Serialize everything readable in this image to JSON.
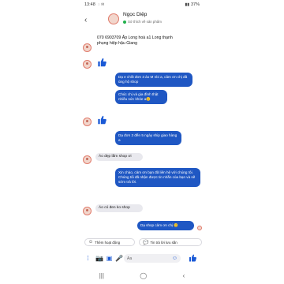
{
  "status": {
    "time": "13:48",
    "battery": "37%"
  },
  "header": {
    "contact_name": "Ngọc Diệp",
    "subtitle": "Sở thích về sản phẩm"
  },
  "messages": [
    {
      "id": "in-1",
      "text": "070 6903709 Ấp Long hoà a1 Long thạnh phụng hiệp hậu Giang"
    },
    {
      "id": "out-1",
      "text": "Dạ e chốt đơn 3 áo M nbi a, cảm ơn chị đã ủng hộ shop"
    },
    {
      "id": "out-2",
      "text": "Chúc chị và gia đình thật nhiều sức khỏe a😊"
    },
    {
      "id": "out-3",
      "text": "Dạ đơn 3 đến 5 ngày ship giao hàng a"
    },
    {
      "id": "in-2",
      "text": "Áo đẹp lắm shop ơi"
    },
    {
      "id": "out-4",
      "text": "Xin chào, cảm ơn bạn đã liên hệ với chúng tôi. Chúng tôi đã nhận được tin nhắn của bạn và sẽ sớm trả lời."
    },
    {
      "id": "in-3",
      "text": "Áo có đen ko shop"
    },
    {
      "id": "out-5",
      "text": "Dạ shop cảm ơn chị 😊"
    }
  ],
  "chips": [
    {
      "label": "Thêm hoạt động",
      "icon": "smile-icon"
    },
    {
      "label": "Tin trả lời lưu sẵn",
      "icon": "chat-bubble-icon"
    }
  ],
  "composer": {
    "placeholder": "Aa"
  },
  "icons": {
    "accent": "#1b5ad6",
    "out_bubble": "#1f57c3"
  }
}
